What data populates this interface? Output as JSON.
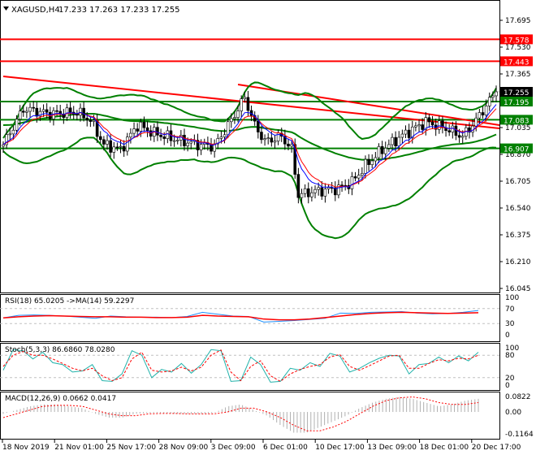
{
  "chart_data": {
    "type": "candlestick",
    "title": "XAGUSD,H4",
    "ohlc_readout": [
      "17.233",
      "17.263",
      "17.233",
      "17.255"
    ],
    "y_ticks": [
      "17.695",
      "17.530",
      "17.365",
      "17.035",
      "16.870",
      "16.705",
      "16.540",
      "16.375",
      "16.210",
      "16.045"
    ],
    "ylim": [
      16.045,
      17.695
    ],
    "x_ticks": [
      "18 Nov 2019",
      "21 Nov 01:00",
      "25 Nov 17:00",
      "28 Nov 09:00",
      "3 Dec 09:00",
      "6 Dec 01:00",
      "10 Dec 17:00",
      "13 Dec 09:00",
      "18 Dec 01:00",
      "20 Dec 17:00"
    ],
    "bars": 148,
    "close_path": [
      [
        0,
        16.93
      ],
      [
        6,
        17.15
      ],
      [
        14,
        17.12
      ],
      [
        22,
        17.13
      ],
      [
        26,
        17.08
      ],
      [
        30,
        16.93
      ],
      [
        35,
        16.9
      ],
      [
        40,
        17.05
      ],
      [
        45,
        17.0
      ],
      [
        52,
        16.96
      ],
      [
        58,
        16.93
      ],
      [
        63,
        16.92
      ],
      [
        68,
        17.08
      ],
      [
        72,
        17.22
      ],
      [
        75,
        17.05
      ],
      [
        78,
        16.95
      ],
      [
        83,
        16.98
      ],
      [
        86,
        16.9
      ],
      [
        88,
        16.62
      ],
      [
        92,
        16.64
      ],
      [
        100,
        16.66
      ],
      [
        104,
        16.7
      ],
      [
        108,
        16.8
      ],
      [
        113,
        16.9
      ],
      [
        120,
        17.0
      ],
      [
        126,
        17.07
      ],
      [
        132,
        17.03
      ],
      [
        137,
        16.98
      ],
      [
        141,
        17.08
      ],
      [
        145,
        17.2
      ],
      [
        147,
        17.255
      ]
    ],
    "current_price": {
      "label": "17.255",
      "value": 17.255,
      "color": "#000000"
    },
    "levels": [
      {
        "label": "17.578",
        "value": 17.578,
        "color": "#ff0000"
      },
      {
        "label": "17.443",
        "value": 17.443,
        "color": "#ff0000"
      },
      {
        "label": "17.195",
        "value": 17.195,
        "color": "#008000"
      },
      {
        "label": "17.083",
        "value": 17.083,
        "color": "#008000"
      },
      {
        "label": "16.907",
        "value": 16.907,
        "color": "#008000"
      }
    ],
    "trendlines": [
      {
        "from": [
          0,
          17.35
        ],
        "to": [
          150,
          17.03
        ],
        "color": "#ff0000"
      },
      {
        "from": [
          70,
          17.3
        ],
        "to": [
          150,
          17.05
        ],
        "color": "#ff0000"
      }
    ],
    "rsi": {
      "label": "RSI(18) 65.0205  ->MA(14) 59.2297",
      "ticks": [
        "100",
        "70",
        "30",
        "0"
      ],
      "line": [
        45,
        52,
        53,
        52,
        50,
        47,
        44,
        50,
        48,
        47,
        47,
        46,
        49,
        60,
        55,
        50,
        49,
        34,
        36,
        38,
        41,
        44,
        58,
        57,
        60,
        61,
        62,
        58,
        56,
        57,
        60,
        65
      ],
      "ma": [
        45,
        48,
        50,
        51,
        50,
        49,
        48,
        48,
        47,
        47,
        46,
        46,
        47,
        52,
        50,
        49,
        48,
        42,
        40,
        40,
        42,
        46,
        50,
        54,
        57,
        59,
        60,
        59,
        58,
        57,
        58,
        59
      ]
    },
    "stoch": {
      "label": "Stoch(5,3,3) 86.6860 78.0280",
      "ticks": [
        "100",
        "80",
        "20",
        "0"
      ],
      "main": [
        40,
        95,
        92,
        70,
        88,
        60,
        55,
        35,
        38,
        55,
        12,
        10,
        30,
        92,
        80,
        20,
        42,
        35,
        58,
        32,
        55,
        95,
        92,
        10,
        12,
        75,
        55,
        8,
        10,
        45,
        40,
        60,
        50,
        85,
        78,
        35,
        45,
        60,
        72,
        80,
        78,
        30,
        55,
        58,
        75,
        60,
        78,
        65,
        88
      ],
      "signal": [
        50,
        80,
        90,
        80,
        80,
        70,
        58,
        45,
        38,
        45,
        25,
        12,
        20,
        70,
        88,
        40,
        35,
        38,
        48,
        38,
        48,
        80,
        94,
        35,
        12,
        50,
        65,
        25,
        10,
        30,
        42,
        50,
        55,
        75,
        82,
        50,
        40,
        52,
        65,
        78,
        80,
        45,
        45,
        58,
        68,
        65,
        72,
        70,
        80
      ]
    },
    "macd": {
      "label": "MACD(12,26,9) 0.0662 0.0417",
      "ticks": [
        "0.0822",
        "0.00",
        "-0.1164"
      ],
      "hist": [
        -0.01,
        0.01,
        0.03,
        0.04,
        0.04,
        0.03,
        0.02,
        -0.01,
        -0.03,
        -0.03,
        -0.01,
        -0.005,
        -0.005,
        -0.01,
        -0.01,
        -0.01,
        -0.005,
        0.03,
        0.04,
        0.01,
        -0.02,
        -0.07,
        -0.11,
        -0.11,
        -0.08,
        -0.05,
        -0.02,
        0.02,
        0.05,
        0.07,
        0.08,
        0.07,
        0.05,
        0.03,
        0.04,
        0.06,
        0.07
      ],
      "signal": [
        -0.03,
        -0.01,
        0.01,
        0.03,
        0.035,
        0.035,
        0.03,
        0.01,
        -0.01,
        -0.02,
        -0.02,
        -0.01,
        -0.008,
        -0.008,
        -0.01,
        -0.01,
        -0.01,
        0.0,
        0.02,
        0.02,
        0.0,
        -0.03,
        -0.07,
        -0.1,
        -0.1,
        -0.08,
        -0.05,
        -0.01,
        0.03,
        0.06,
        0.075,
        0.08,
        0.07,
        0.05,
        0.04,
        0.04,
        0.05
      ]
    }
  }
}
